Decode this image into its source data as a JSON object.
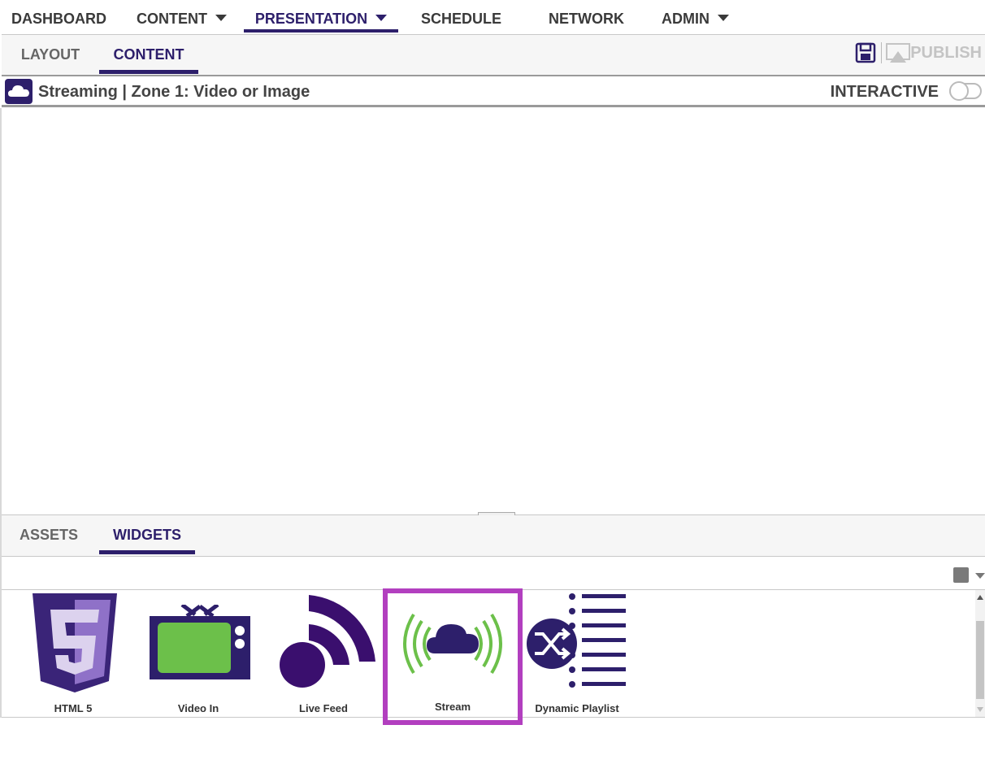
{
  "nav": {
    "items": [
      {
        "label": "DASHBOARD"
      },
      {
        "label": "CONTENT"
      },
      {
        "label": "PRESENTATION"
      },
      {
        "label": "SCHEDULE"
      },
      {
        "label": "NETWORK"
      },
      {
        "label": "ADMIN"
      }
    ]
  },
  "editor_tabs": {
    "layout": "LAYOUT",
    "content": "CONTENT",
    "publish": "PUBLISH"
  },
  "zone": {
    "title": "Streaming | Zone 1: Video or Image",
    "interactive_label": "INTERACTIVE",
    "interactive_on": false
  },
  "library_tabs": {
    "assets": "ASSETS",
    "widgets": "WIDGETS"
  },
  "widgets": [
    {
      "label": "HTML 5",
      "icon": "html5-icon"
    },
    {
      "label": "Video In",
      "icon": "tv-icon"
    },
    {
      "label": "Live Feed",
      "icon": "rss-feed-icon"
    },
    {
      "label": "Stream",
      "icon": "cloud-stream-icon",
      "selected": true
    },
    {
      "label": "Dynamic Playlist",
      "icon": "shuffle-list-icon"
    }
  ],
  "colors": {
    "brand_purple": "#2d1f6b",
    "accent_green": "#6cc04a",
    "selection_magenta": "#b23fbf"
  }
}
